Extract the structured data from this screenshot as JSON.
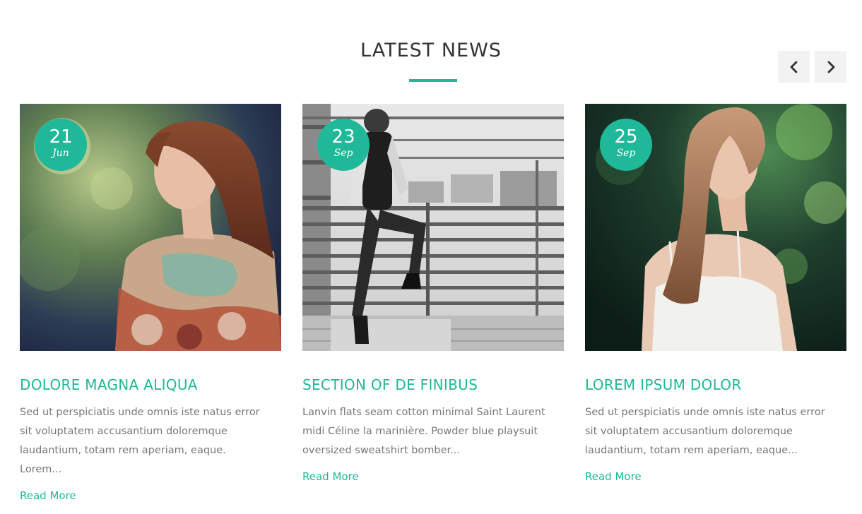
{
  "section": {
    "title": "LATEST NEWS"
  },
  "carousel": {
    "prev_icon": "chevron-left-icon",
    "next_icon": "chevron-right-icon"
  },
  "colors": {
    "accent": "#1fb898",
    "heading": "#333333",
    "body_text": "#777777",
    "nav_bg": "#f2f2f2"
  },
  "posts": [
    {
      "day": "21",
      "month": "Jun",
      "title": "DOLORE MAGNA ALIQUA",
      "excerpt": "Sed ut perspiciatis unde omnis iste natus error sit voluptatem accusantium doloremque laudantium, totam rem aperiam, eaque. Lorem...",
      "read_more": "Read More"
    },
    {
      "day": "23",
      "month": "Sep",
      "title": "SECTION OF DE FINIBUS",
      "excerpt": "Lanvin flats seam cotton minimal Saint Laurent midi Céline la marinière. Powder blue playsuit oversized sweatshirt bomber...",
      "read_more": "Read More"
    },
    {
      "day": "25",
      "month": "Sep",
      "title": "LOREM IPSUM DOLOR",
      "excerpt": "Sed ut perspiciatis unde omnis iste natus error sit voluptatem accusantium doloremque laudantium, totam rem aperiam, eaque...",
      "read_more": "Read More"
    }
  ]
}
